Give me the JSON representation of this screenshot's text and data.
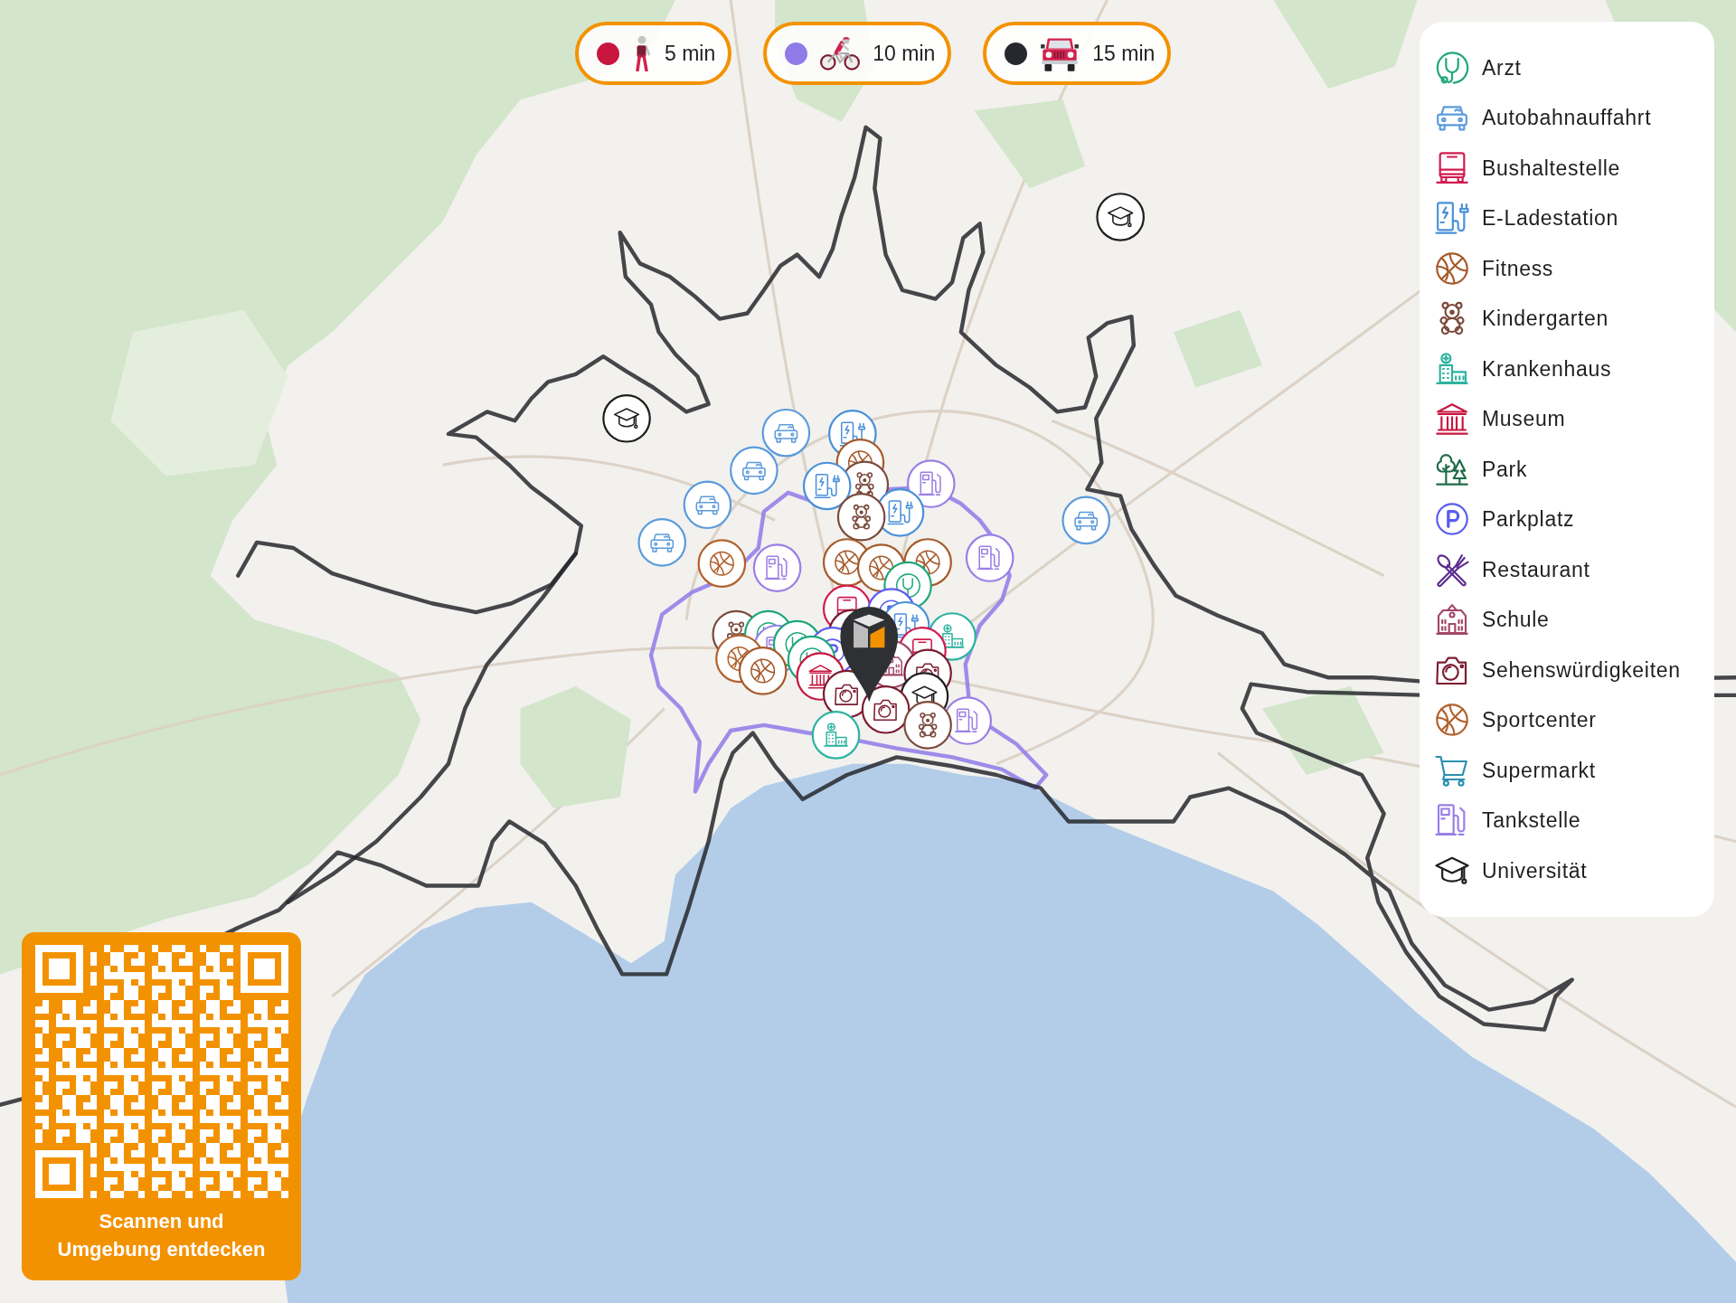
{
  "travel_times": [
    {
      "kind": "walk",
      "label": "5 min",
      "color": "#c8163f"
    },
    {
      "kind": "bike",
      "label": "10 min",
      "color": "#8f7ae8"
    },
    {
      "kind": "car",
      "label": "15 min",
      "color": "#26282d"
    }
  ],
  "legend": {
    "items": [
      {
        "kind": "doctor",
        "label": "Arzt"
      },
      {
        "kind": "highway",
        "label": "Autobahnauffahrt"
      },
      {
        "kind": "bus",
        "label": "Bushaltestelle"
      },
      {
        "kind": "charging",
        "label": "E-Ladestation"
      },
      {
        "kind": "fitness",
        "label": "Fitness"
      },
      {
        "kind": "kindergarten",
        "label": "Kindergarten"
      },
      {
        "kind": "hospital",
        "label": "Krankenhaus"
      },
      {
        "kind": "museum",
        "label": "Museum"
      },
      {
        "kind": "park",
        "label": "Park"
      },
      {
        "kind": "parking",
        "label": "Parkplatz"
      },
      {
        "kind": "restaurant",
        "label": "Restaurant"
      },
      {
        "kind": "school",
        "label": "Schule"
      },
      {
        "kind": "sights",
        "label": "Sehenswürdigkeiten"
      },
      {
        "kind": "sportcenter",
        "label": "Sportcenter"
      },
      {
        "kind": "supermarket",
        "label": "Supermarkt"
      },
      {
        "kind": "fuel",
        "label": "Tankstelle"
      },
      {
        "kind": "university",
        "label": "Universität"
      }
    ]
  },
  "qr_card": {
    "caption": "Scannen und\nUmgebung entdecken"
  }
}
